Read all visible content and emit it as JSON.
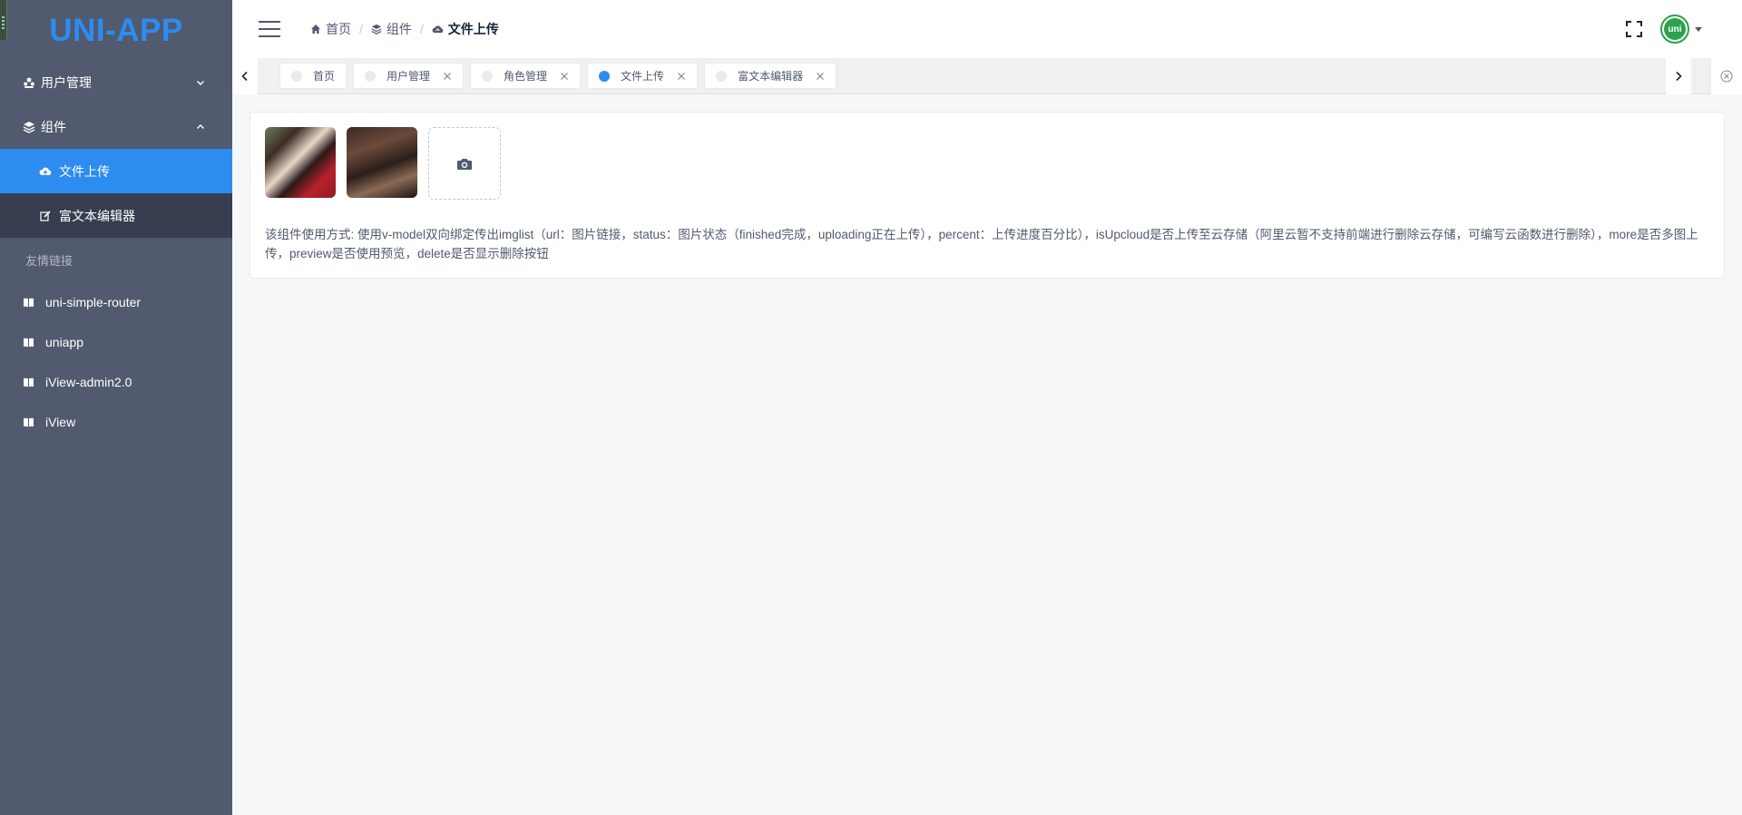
{
  "app": {
    "logo": "UNI-APP"
  },
  "sidebar": {
    "menu": [
      {
        "label": "用户管理",
        "icon": "users-icon",
        "expanded": false
      },
      {
        "label": "组件",
        "icon": "layers-icon",
        "expanded": true,
        "children": [
          {
            "label": "文件上传",
            "icon": "cloud-upload-icon",
            "active": true
          },
          {
            "label": "富文本编辑器",
            "icon": "edit-icon",
            "active": false
          }
        ]
      }
    ],
    "links_title": "友情链接",
    "links": [
      {
        "label": "uni-simple-router",
        "icon": "book-icon"
      },
      {
        "label": "uniapp",
        "icon": "book-icon"
      },
      {
        "label": "iView-admin2.0",
        "icon": "book-icon"
      },
      {
        "label": "iView",
        "icon": "book-icon"
      }
    ]
  },
  "header": {
    "breadcrumb": [
      {
        "label": "首页",
        "icon": "home-icon"
      },
      {
        "label": "组件",
        "icon": "layers-icon"
      },
      {
        "label": "文件上传",
        "icon": "cloud-upload-icon"
      }
    ],
    "avatar_text": "uni"
  },
  "tags": [
    {
      "label": "首页",
      "closable": false,
      "active": false
    },
    {
      "label": "用户管理",
      "closable": true,
      "active": false
    },
    {
      "label": "角色管理",
      "closable": true,
      "active": false
    },
    {
      "label": "文件上传",
      "closable": true,
      "active": true
    },
    {
      "label": "富文本编辑器",
      "closable": true,
      "active": false
    }
  ],
  "content": {
    "description": "该组件使用方式: 使用v-model双向绑定传出imglist（url：图片链接，status：图片状态（finished完成，uploading正在上传），percent：上传进度百分比），isUpcloud是否上传至云存储（阿里云暂不支持前端进行删除云存储，可编写云函数进行删除），more是否多图上传，preview是否使用预览，delete是否显示删除按钮"
  },
  "colors": {
    "sidebar": "#515a6e",
    "submenu": "#363e4f",
    "accent": "#2d8cf0",
    "avatar": "#2ba24c"
  }
}
